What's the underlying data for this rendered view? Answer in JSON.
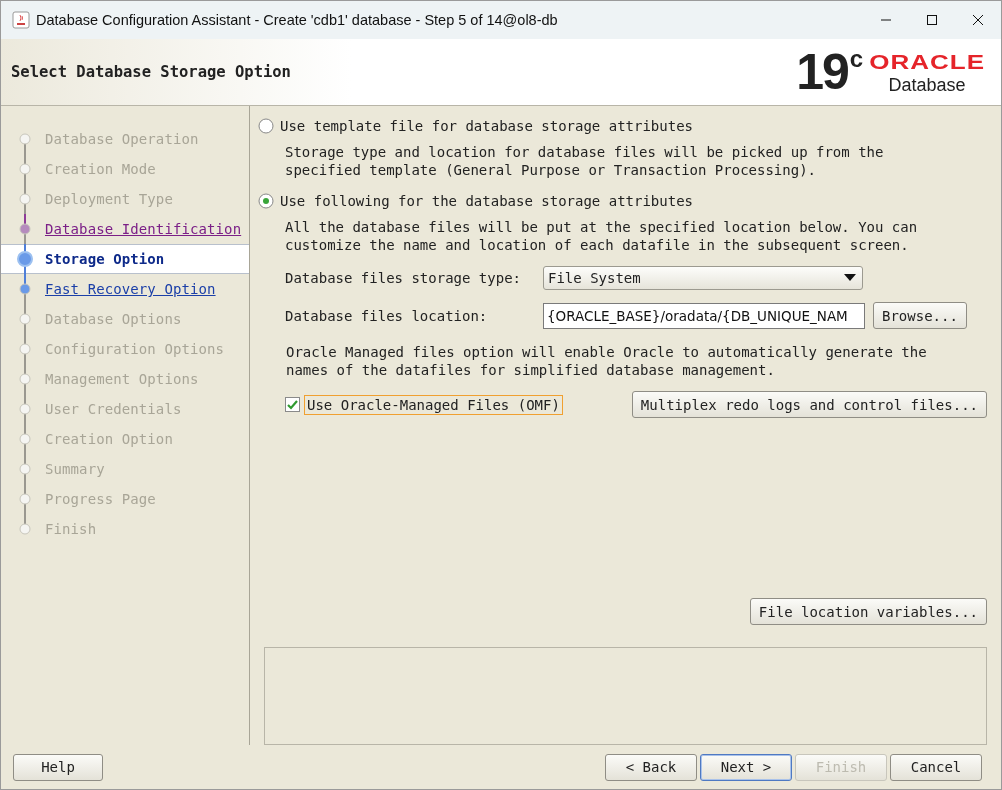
{
  "window": {
    "title": "Database Configuration Assistant - Create 'cdb1' database - Step 5 of 14@ol8-db"
  },
  "header": {
    "title": "Select Database Storage Option",
    "version": "19",
    "version_suffix": "c",
    "brand": "ORACLE",
    "product": "Database"
  },
  "steps": [
    {
      "label": "Database Operation",
      "kind": "done",
      "selected": false
    },
    {
      "label": "Creation Mode",
      "kind": "done",
      "selected": false
    },
    {
      "label": "Deployment Type",
      "kind": "done",
      "selected": false
    },
    {
      "label": "Database Identification",
      "kind": "visited",
      "selected": false
    },
    {
      "label": "Storage Option",
      "kind": "current",
      "selected": true
    },
    {
      "label": "Fast Recovery Option",
      "kind": "link",
      "selected": false
    },
    {
      "label": "Database Options",
      "kind": "pending",
      "selected": false
    },
    {
      "label": "Configuration Options",
      "kind": "pending",
      "selected": false
    },
    {
      "label": "Management Options",
      "kind": "pending",
      "selected": false
    },
    {
      "label": "User Credentials",
      "kind": "pending",
      "selected": false
    },
    {
      "label": "Creation Option",
      "kind": "pending",
      "selected": false
    },
    {
      "label": "Summary",
      "kind": "pending",
      "selected": false
    },
    {
      "label": "Progress Page",
      "kind": "pending",
      "selected": false
    },
    {
      "label": "Finish",
      "kind": "pending",
      "selected": false
    }
  ],
  "options": [
    {
      "label": "Use template file for database storage attributes",
      "selected": false,
      "description": "Storage type and location for database files will be picked up from the specified template (General Purpose or Transaction Processing)."
    },
    {
      "label": "Use following for the database storage attributes",
      "selected": true,
      "description": "All the database files will be put at the specified location below. You can customize the name and location of each datafile in the subsequent screen."
    }
  ],
  "storage_type": {
    "label": "Database files storage type:",
    "value": "File System"
  },
  "location": {
    "label": "Database files location:",
    "value": "{ORACLE_BASE}/oradata/{DB_UNIQUE_NAM",
    "browse": "Browse..."
  },
  "omf_note": "Oracle Managed files option will enable Oracle to automatically generate the names of the datafiles for simplified database management.",
  "omf": {
    "label": "Use Oracle-Managed Files (OMF)",
    "checked": true
  },
  "multiplex_button": "Multiplex redo logs and control files...",
  "variables_button": "File location variables...",
  "buttons": [
    {
      "label": "Help",
      "kind": "left",
      "disabled": false,
      "selected": false
    },
    {
      "label": "< Back",
      "kind": "right",
      "disabled": false,
      "selected": false
    },
    {
      "label": "Next >",
      "kind": "right",
      "disabled": false,
      "selected": true
    },
    {
      "label": "Finish",
      "kind": "right",
      "disabled": true,
      "selected": false
    },
    {
      "label": "Cancel",
      "kind": "right",
      "disabled": false,
      "selected": false
    }
  ]
}
